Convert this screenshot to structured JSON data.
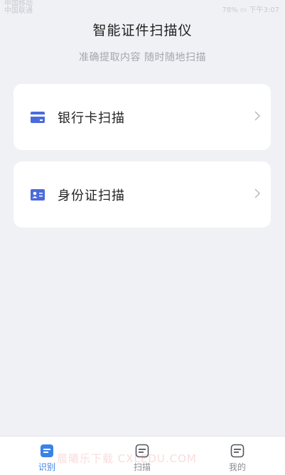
{
  "status_bar": {
    "carrier_line1": "中国移动",
    "carrier_line2": "中国联通",
    "battery": "78%",
    "time": "下午3:07"
  },
  "header": {
    "title": "智能证件扫描仪",
    "subtitle": "准确提取内容 随时随地扫描"
  },
  "cards": [
    {
      "label": "银行卡扫描",
      "icon": "bank-card-icon"
    },
    {
      "label": "身份证扫描",
      "icon": "id-card-icon"
    }
  ],
  "tabbar": {
    "tabs": [
      {
        "label": "识别",
        "icon": "document-icon",
        "active": true
      },
      {
        "label": "扫描",
        "icon": "document-icon",
        "active": false
      },
      {
        "label": "我的",
        "icon": "document-icon",
        "active": false
      }
    ]
  },
  "watermark": "晨曦乐下载 CXLEDU.COM",
  "colors": {
    "background": "#f0f1f5",
    "card": "#ffffff",
    "accent": "#3b82e8",
    "icon_blue": "#4a6bdc",
    "tab_inactive": "#8a8c93"
  }
}
